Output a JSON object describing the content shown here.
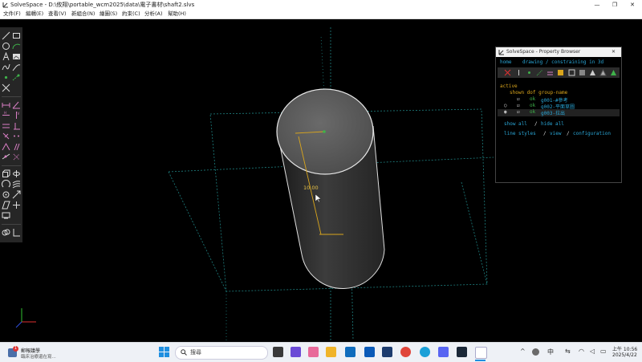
{
  "window": {
    "title": "SolveSpace - D:\\攸翔\\portable_wcm2025\\data\\電子書材\\shaft2.slvs",
    "minimize_glyph": "—",
    "maximize_glyph": "❐",
    "close_glyph": "✕"
  },
  "menu": [
    "文件(F)",
    "編輯(E)",
    "查看(V)",
    "新組合(N)",
    "繪圖(S)",
    "約束(C)",
    "分析(A)",
    "幫助(H)"
  ],
  "viewport": {
    "dimension_label": "10.00"
  },
  "property_browser": {
    "title": "SolveSpace - Property Browser",
    "close_glyph": "✕",
    "nav_home": "home",
    "nav_status": "drawing / constraining in 3d",
    "section": "active",
    "columns": "shown dof group-name",
    "groups": [
      {
        "dof": "ok",
        "name": "g001-#參考"
      },
      {
        "dof": "ok",
        "name": "g002-平面草圖"
      },
      {
        "dof": "ok",
        "name": "g003-拉出"
      }
    ],
    "show_all": "show all",
    "hide_all": "hide all",
    "line_styles": "line styles",
    "view": "view",
    "configuration": "configuration",
    "separator": "/"
  },
  "taskbar": {
    "notify_title": "郵報議學",
    "notify_sub": "臨床治療還在寫...",
    "notify_badge": "1",
    "search_placeholder": "搜尋",
    "ime": "中",
    "time": "上午 10:56",
    "date": "2025/4/22"
  },
  "colors": {
    "toolbar_bg": "#262626",
    "accent_cyan": "#2aa6d6",
    "dimension_yellow": "#d9a51c",
    "ok_green": "#3fb24a"
  }
}
